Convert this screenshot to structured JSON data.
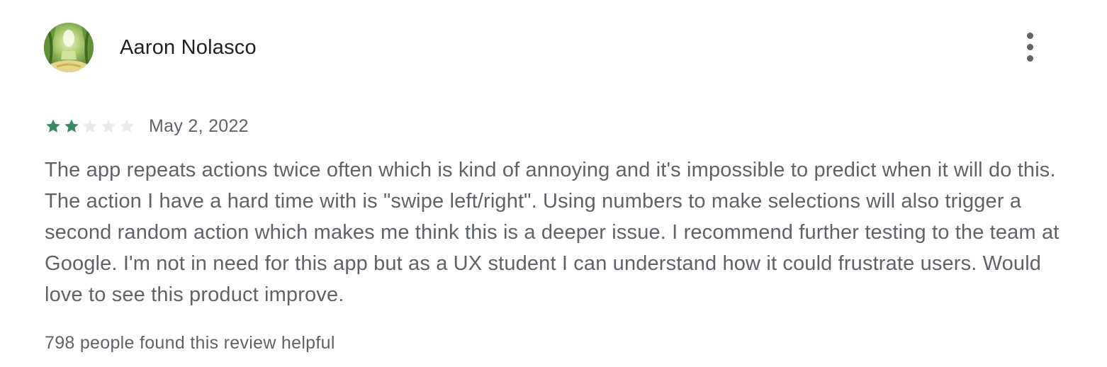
{
  "review": {
    "author": "Aaron Nolasco",
    "avatar_icon": "forest-avatar-image",
    "more_icon": "more-vert-icon",
    "rating": 2,
    "rating_max": 5,
    "star_filled_color": "#3c8a63",
    "star_empty_color": "#e8eaed",
    "date": "May 2, 2022",
    "text": "The app repeats actions twice often which is kind of annoying and it's impossible to predict when it will do this. The action I have a hard time with is \"swipe left/right\". Using numbers to make selections will also trigger a second random action which makes me think this is a deeper issue. I recommend further testing to the team at Google. I'm not in need for this app but as a UX student I can understand how it could frustrate users. Would love to see this product improve.",
    "helpful": "798 people found this review helpful"
  }
}
